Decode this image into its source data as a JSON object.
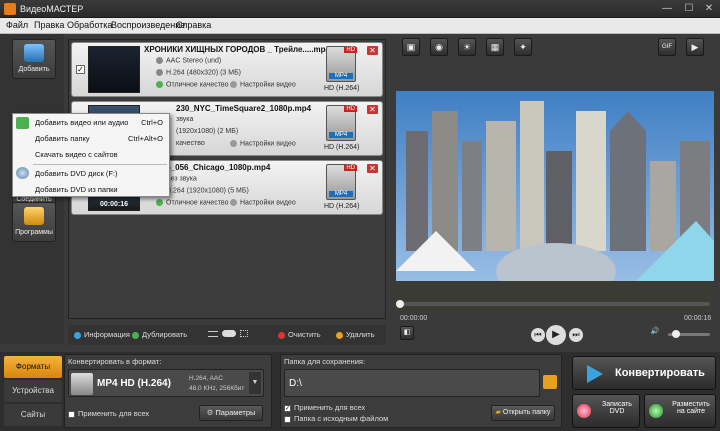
{
  "app": {
    "title": "ВидеоМАСТЕР"
  },
  "window_controls": {
    "minimize": "—",
    "maximize": "☐",
    "close": "✕"
  },
  "menu": [
    "Файл",
    "Правка",
    "Обработка",
    "Воспроизведение",
    "Справка"
  ],
  "tools": [
    {
      "label": "Добавить",
      "icon": "add-file-icon"
    },
    {
      "label": "Соединить",
      "icon": "join-icon"
    },
    {
      "label": "Программы",
      "icon": "programs-icon"
    }
  ],
  "dropdown": [
    {
      "label": "Добавить видео или аудио",
      "shortcut": "Ctrl+O"
    },
    {
      "label": "Добавить папку",
      "shortcut": "Ctrl+Alt+O"
    },
    {
      "label": "Скачать видео с сайтов",
      "shortcut": ""
    },
    {
      "label": "Добавить DVD диск (F:)",
      "shortcut": ""
    },
    {
      "label": "Добавить DVD из папки",
      "shortcut": ""
    }
  ],
  "files": [
    {
      "name": "ХРОНИКИ ХИЩНЫХ ГОРОДОВ _ Трейле.....mp4",
      "audio": "AAC Stereo (und)",
      "video": "H.264 (480x320) (3 МБ)",
      "quality": "Отличное качество",
      "settings": "Настройки видео",
      "format": "HD (H.264)",
      "duration": "",
      "checked": "✓"
    },
    {
      "name": "230_NYC_TimeSquare2_1080p.mp4",
      "audio": "звука",
      "video": "(1920x1080) (2 МБ)",
      "quality": "качество",
      "settings": "Настройки видео",
      "format": "HD (H.264)",
      "duration": "",
      "checked": ""
    },
    {
      "name": "160725_056_Chicago_1080p.mp4",
      "audio": "Без звука",
      "video": "H.264 (1920x1080) (5 МБ)",
      "quality": "Отличное качество",
      "settings": "Настройки видео",
      "format": "HD (H.264)",
      "duration": "00:00:16",
      "checked": "✓"
    }
  ],
  "format_badge": {
    "hd": "HD",
    "mp4": "MP4"
  },
  "file_toolbar": {
    "info": "Информация",
    "duplicate": "Дублировать",
    "clear": "Очистить",
    "delete": "Удалить"
  },
  "player": {
    "gif": "GIF",
    "time_current": "00:00:00",
    "time_total": "00:00:16"
  },
  "side_tabs": [
    "Форматы",
    "Устройства",
    "Сайты"
  ],
  "convert_format": {
    "label": "Конвертировать в формат:",
    "name": "MP4 HD (H.264)",
    "codec": "H.264, AAC",
    "audio": "48,0 KHz, 256Кбит",
    "apply_all": "Применить для всех",
    "params": "Параметры"
  },
  "save": {
    "label": "Папка для сохранения:",
    "path": "D:\\",
    "apply_all": "Применить для всех",
    "source_folder": "Папка с исходным файлом",
    "open_folder": "Открыть папку"
  },
  "actions": {
    "convert": "Конвертировать",
    "dvd_line1": "Записать",
    "dvd_line2": "DVD",
    "web_line1": "Разместить",
    "web_line2": "на сайте"
  },
  "colors": {
    "accent": "#e8a020",
    "convert_icon": "#39a3e0"
  }
}
